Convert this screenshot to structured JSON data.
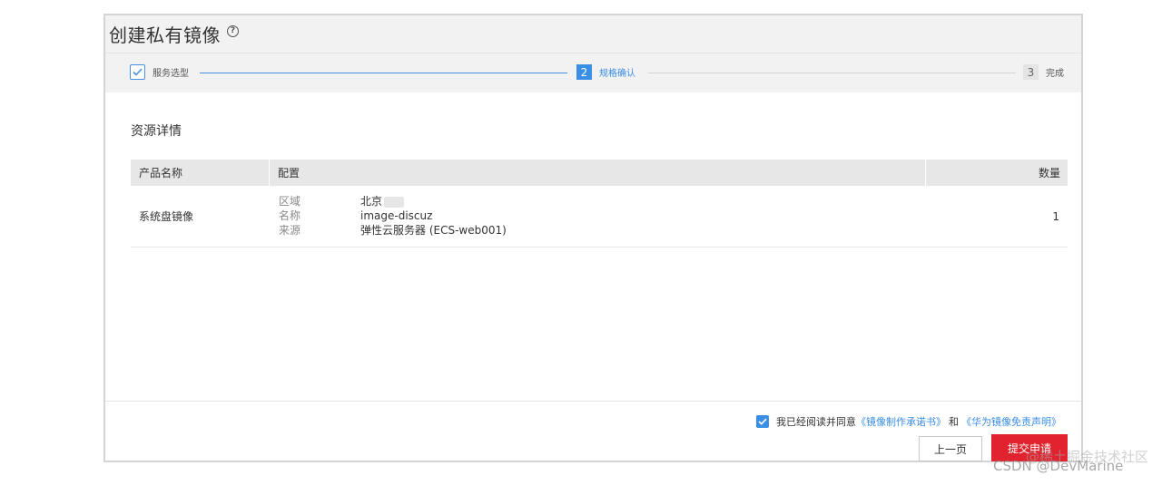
{
  "dialog": {
    "title": "创建私有镜像",
    "help_icon_glyph": "?"
  },
  "steps": [
    {
      "label": "服务选型",
      "state": "done"
    },
    {
      "number": "2",
      "label": "规格确认",
      "state": "active"
    },
    {
      "number": "3",
      "label": "完成",
      "state": "todo"
    }
  ],
  "section": {
    "title": "资源详情"
  },
  "table": {
    "headers": [
      "产品名称",
      "配置",
      "数量"
    ],
    "rows": [
      {
        "product": "系统盘镜像",
        "config": [
          {
            "key": "区域",
            "value": "北京"
          },
          {
            "key": "名称",
            "value": "image-discuz"
          },
          {
            "key": "来源",
            "value": "弹性云服务器 (ECS-web001)"
          }
        ],
        "quantity": "1"
      }
    ]
  },
  "footer": {
    "agree_prefix": "我已经阅读并同意",
    "link1": "《镜像制作承诺书》",
    "and": "和",
    "link2": "《华为镜像免责声明》",
    "prev_label": "上一页",
    "submit_label": "提交申请"
  },
  "watermark": {
    "line1": "@稀土掘金技术社区",
    "line2": "CSDN @DevMarine"
  },
  "colors": {
    "accent": "#3a8ee6",
    "submit": "#e0232e"
  }
}
